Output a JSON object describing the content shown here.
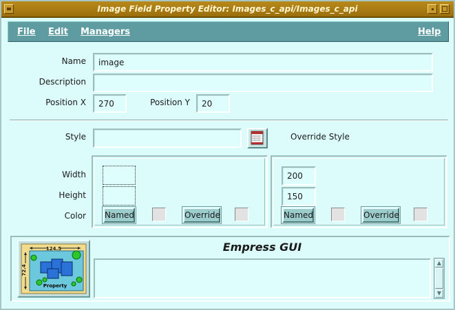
{
  "window": {
    "title": "Image Field Property Editor: Images_c_api/Images_c_api",
    "accent": "#a77b12",
    "menubar_color": "#5e9ca2",
    "background": "#dcfcfc"
  },
  "menubar": {
    "file": "File",
    "edit": "Edit",
    "managers": "Managers",
    "help": "Help"
  },
  "form": {
    "name_label": "Name",
    "name_value": "image",
    "description_label": "Description",
    "description_value": "",
    "position_x_label": "Position X",
    "position_x_value": "270",
    "position_y_label": "Position Y",
    "position_y_value": "20"
  },
  "style": {
    "style_label": "Style",
    "style_value": "",
    "override_style_label": "Override Style",
    "style_picker_icon": "style-list-icon"
  },
  "dimensions": {
    "width_label": "Width",
    "height_label": "Height",
    "color_label": "Color",
    "left": {
      "width_value": "",
      "height_value": "",
      "named_button": "Named",
      "override_button": "Override"
    },
    "right": {
      "width_value": "200",
      "height_value": "150",
      "named_button": "Named",
      "override_button": "Override"
    }
  },
  "footer": {
    "brand": "Empress GUI",
    "logo_icon": "property-map-icon",
    "logo_top_dim": "124.5",
    "logo_side_dim": "72.4",
    "logo_label": "Property",
    "message_text": ""
  }
}
